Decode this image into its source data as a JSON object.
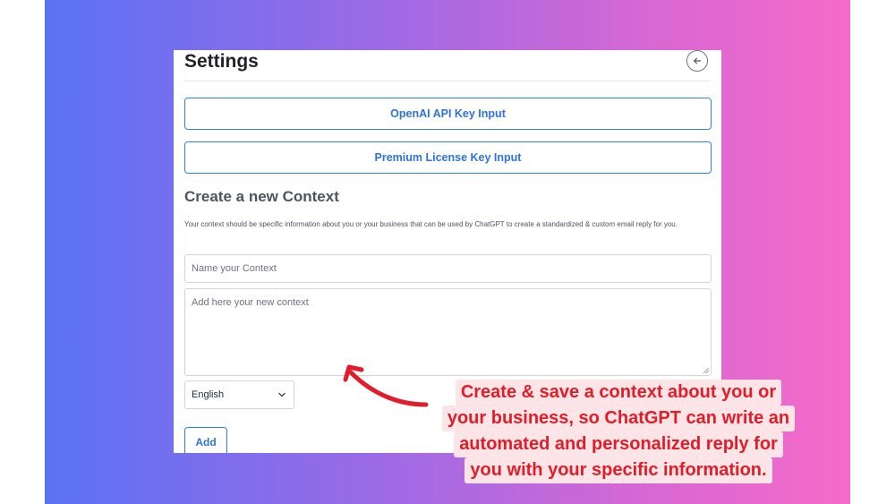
{
  "settings": {
    "title": "Settings",
    "back_icon": "arrow-left-icon",
    "api_key_button": "OpenAI API Key Input",
    "license_key_button": "Premium License Key Input"
  },
  "context": {
    "section_title": "Create a new Context",
    "description": "Your context should be specific information about you or your business that can be used by ChatGPT to create a standardized & custom email reply for you.",
    "name_placeholder": "Name your Context",
    "context_placeholder": "Add here your new context",
    "language_selected": "English",
    "add_button": "Add"
  },
  "callout": {
    "lines": [
      "Create & save a context about you or",
      "your business, so ChatGPT can write an",
      "automated and personalized reply for",
      "you with your specific information."
    ]
  },
  "colors": {
    "accent_blue": "#2f80ed",
    "callout_red": "#e11d2a",
    "callout_bg": "#fde4e6",
    "gradient_left": "#5a72f5",
    "gradient_right": "#f66ac8"
  }
}
